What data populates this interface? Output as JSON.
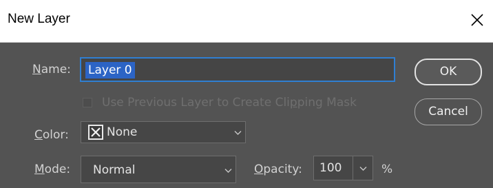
{
  "window": {
    "title": "New Layer",
    "close_glyph": "×"
  },
  "name_row": {
    "label_key": "N",
    "label_rest": "ame:",
    "value": "Layer 0"
  },
  "clip_row": {
    "label_pre": "Use Previous Layer to Create Cli",
    "label_key": "p",
    "label_post": "ping Mask",
    "checked": false,
    "enabled": false
  },
  "color_row": {
    "label_key": "C",
    "label_rest": "olor:",
    "value": "None",
    "swatch_icon": "x-mark-icon"
  },
  "mode_row": {
    "label_key": "M",
    "label_rest": "ode:",
    "value": "Normal"
  },
  "opacity_row": {
    "label_key": "O",
    "label_rest": "pacity:",
    "value": "100",
    "unit": "%"
  },
  "buttons": {
    "ok": "OK",
    "cancel": "Cancel"
  },
  "colors": {
    "dialog_bg": "#535353",
    "field_bg": "#464646",
    "focus_border": "#2f7fd3",
    "selection": "#2c64c5"
  }
}
